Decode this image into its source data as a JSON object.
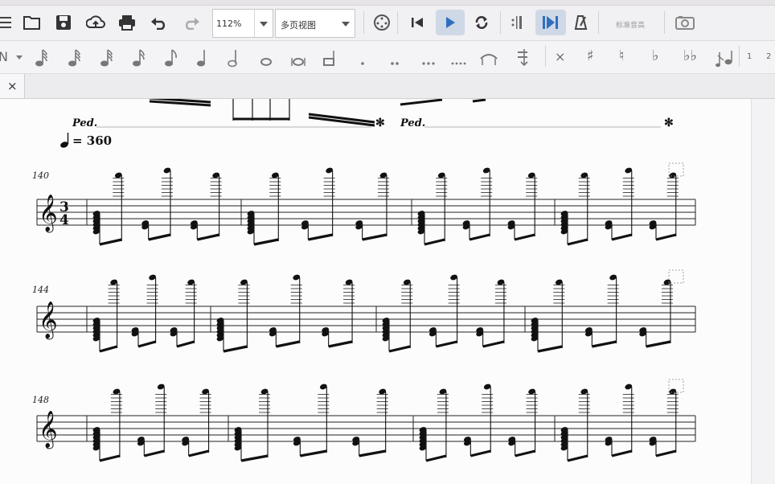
{
  "toolbar": {
    "zoom_value": "112%",
    "view_mode": "多页视图",
    "concert_pitch_label": "标准音高",
    "buttons": [
      "new-icon",
      "open-icon",
      "save-icon",
      "cloud-upload-icon",
      "print-icon",
      "undo-icon",
      "redo-icon",
      "mixer-icon",
      "rewind-icon",
      "play-icon",
      "loop-icon",
      "repeat-icon",
      "pan-icon",
      "metronome-icon",
      "concert-pitch",
      "image-capture-icon"
    ]
  },
  "palette": {
    "items": [
      "N",
      "𝅘𝅥𝅱",
      "𝅘𝅥𝅰",
      "𝅘𝅥𝅯",
      "𝅘𝅥𝅮",
      "♪",
      "♩",
      "𝅗𝅥",
      "𝅝",
      "𝅜",
      "𝆹",
      "·",
      "··",
      "···",
      "tie",
      "flip",
      "×",
      "#",
      "♮",
      "♭",
      "𝄫",
      "acciaccatura",
      "1",
      "2"
    ],
    "voice_1": "1",
    "voice_2": "2"
  },
  "tab": {
    "close_label": "×"
  },
  "score": {
    "tempo_label": "= 360",
    "pedal_label": "Ped.",
    "pedal_release": "✻",
    "measure_numbers": [
      "140",
      "144",
      "148"
    ],
    "time_signature": {
      "top": "3",
      "bottom": "4"
    }
  }
}
